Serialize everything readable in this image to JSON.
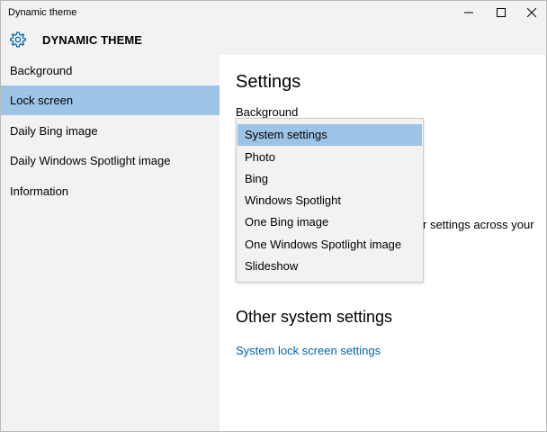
{
  "window": {
    "title": "Dynamic theme"
  },
  "header": {
    "app_title": "DYNAMIC THEME",
    "icon": "gear-icon"
  },
  "sidebar": {
    "items": [
      {
        "label": "Background",
        "selected": false
      },
      {
        "label": "Lock screen",
        "selected": true
      },
      {
        "label": "Daily Bing image",
        "selected": false
      },
      {
        "label": "Daily Windows Spotlight image",
        "selected": false
      },
      {
        "label": "Information",
        "selected": false
      }
    ]
  },
  "main": {
    "heading": "Settings",
    "background_label": "Background",
    "partial_text_1": "r settings across your",
    "partial_text_2": "",
    "other_heading": "Other system settings",
    "lock_link": "System lock screen settings"
  },
  "dropdown": {
    "options": [
      {
        "label": "System settings",
        "selected": true
      },
      {
        "label": "Photo",
        "selected": false
      },
      {
        "label": "Bing",
        "selected": false
      },
      {
        "label": "Windows Spotlight",
        "selected": false
      },
      {
        "label": "One Bing image",
        "selected": false
      },
      {
        "label": "One Windows Spotlight image",
        "selected": false
      },
      {
        "label": "Slideshow",
        "selected": false
      }
    ]
  },
  "colors": {
    "accent": "#0063b1",
    "selection": "#9dc3e6",
    "chrome": "#f2f2f2"
  }
}
